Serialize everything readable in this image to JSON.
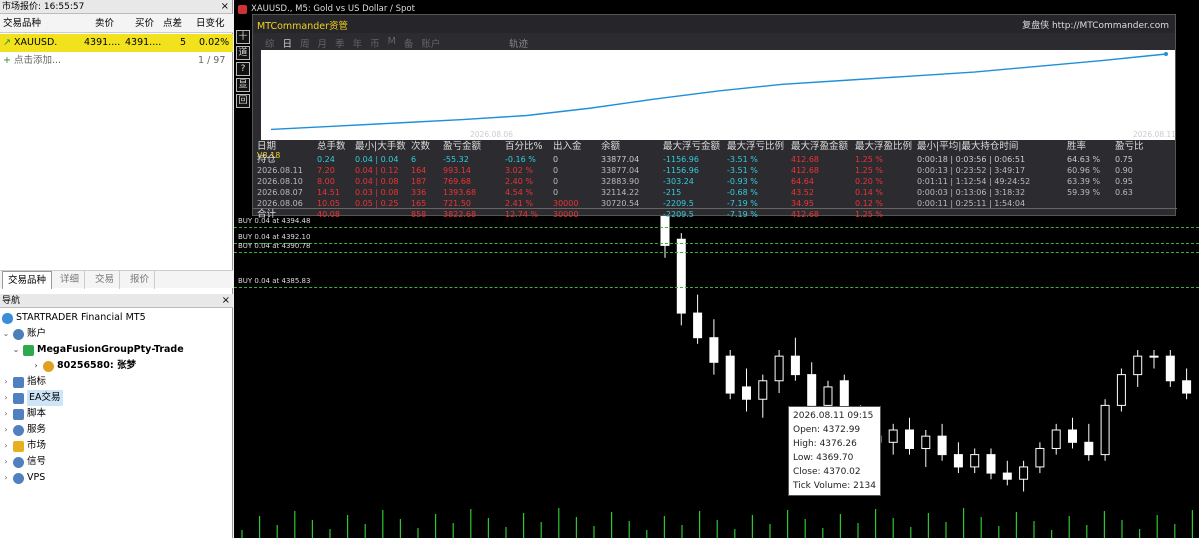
{
  "market_watch": {
    "title": "市场报价: 16:55:57",
    "columns": [
      "交易品种",
      "卖价",
      "买价",
      "点差",
      "日变化"
    ],
    "rows": [
      {
        "symbol": "XAUUSD.",
        "bid": "4391....",
        "ask": "4391....",
        "spread": "5",
        "change": "0.02%"
      }
    ],
    "add_label": "点击添加...",
    "count": "1 / 97",
    "tabs": [
      "交易品种",
      "详细",
      "交易",
      "报价"
    ]
  },
  "navigator": {
    "title": "导航",
    "items": [
      {
        "label": "STARTRADER Financial MT5",
        "color": "#3a8ed8"
      },
      {
        "label": "账户",
        "color": "#4a7fb8"
      },
      {
        "label": "MegaFusionGroupPty-Trade",
        "color": "#2fa84e"
      },
      {
        "label": "80256580: 张梦",
        "color": "#e0a020"
      },
      {
        "label": "指标",
        "color": "#5080c0"
      },
      {
        "label": "EA交易",
        "color": "#5080c0"
      },
      {
        "label": "脚本",
        "color": "#5080c0"
      },
      {
        "label": "服务",
        "color": "#5080c0"
      },
      {
        "label": "市场",
        "color": "#e8b020"
      },
      {
        "label": "信号",
        "color": "#5080c0"
      },
      {
        "label": "VPS",
        "color": "#5080c0"
      }
    ]
  },
  "chart": {
    "title": "XAUUSD., M5:  Gold vs US Dollar / Spot",
    "toolbar": [
      "十",
      "道",
      "?",
      "显",
      "回"
    ]
  },
  "mtc": {
    "title": "MTCommander资管",
    "link": "复盘侠  http://MTCommander.com",
    "tabs": [
      "综",
      "日",
      "周",
      "月",
      "季",
      "年",
      "币",
      "M",
      "备",
      "账户"
    ],
    "traj": "轨迹",
    "date_start": "2026.08.06",
    "date_end": "2026.08.11",
    "version": "V8.18",
    "equity": [
      0.08,
      0.12,
      0.16,
      0.2,
      0.25,
      0.34,
      0.45,
      0.55,
      0.63,
      0.68,
      0.73,
      0.78,
      0.85,
      0.92,
      1.0
    ],
    "headers": [
      "日期",
      "总手数",
      "最小|大手数",
      "次数",
      "盈亏金额",
      "百分比%",
      "出入金",
      "余额",
      "最大浮亏金额",
      "最大浮亏比例",
      "最大浮盈金额",
      "最大浮盈比例",
      "最小|平均|最大持仓时间",
      "胜率",
      "盈亏比"
    ],
    "rows": [
      [
        "持仓",
        "0.24",
        "0.04 | 0.04",
        "6",
        "-55.32",
        "-0.16 %",
        "0",
        "33877.04",
        "-1156.96",
        "-3.51 %",
        "412.68",
        "1.25 %",
        "0:00:18 | 0:03:56 | 0:06:51",
        "64.63 %",
        "0.75"
      ],
      [
        "2026.08.11",
        "7.20",
        "0.04 | 0.12",
        "164",
        "993.14",
        "3.02 %",
        "0",
        "33877.04",
        "-1156.96",
        "-3.51 %",
        "412.68",
        "1.25 %",
        "0:00:13 | 0:23:52 | 3:49:17",
        "60.96 %",
        "0.90"
      ],
      [
        "2026.08.10",
        "8.00",
        "0.04 | 0.08",
        "187",
        "769.68",
        "2.40 %",
        "0",
        "32883.90",
        "-303.24",
        "-0.93 %",
        "64.64",
        "0.20 %",
        "0:01:11 | 1:12:54 | 49:24:52",
        "63.39 %",
        "0.95"
      ],
      [
        "2026.08.07",
        "14.51",
        "0.03 | 0.08",
        "336",
        "1393.68",
        "4.54 %",
        "0",
        "32114.22",
        "-215",
        "-0.68 %",
        "43.52",
        "0.14 %",
        "0:00:03 | 0:13:06 | 3:18:32",
        "59.39 %",
        "0.63"
      ],
      [
        "2026.08.06",
        "10.05",
        "0.05 | 0.25",
        "165",
        "721.50",
        "2.41 %",
        "30000",
        "30720.54",
        "-2209.5",
        "-7.19 %",
        "34.95",
        "0.12 %",
        "0:00:11 | 0:25:11 | 1:54:04",
        "",
        ""
      ],
      [
        "合计",
        "40.08",
        "",
        "858",
        "3822.68",
        "12.74 %",
        "30000",
        "",
        "-2209.5",
        "-7.19 %",
        "412.68",
        "1.25 %",
        "",
        "",
        ""
      ]
    ]
  },
  "positions": [
    "BUY 0.04 at 4394.48",
    "BUY 0.04 at 4392.10",
    "BUY 0.04 at 4390.78",
    "BUY 0.04 at 4385.83"
  ],
  "tooltip": {
    "date": "2026.08.11 09:15",
    "open": "Open: 4372.99",
    "high": "High: 4376.26",
    "low": "Low: 4369.70",
    "close": "Close: 4370.02",
    "volume": "Tick Volume: 2134"
  },
  "candles": [
    {
      "o": 4398,
      "h": 4400,
      "l": 4391,
      "c": 4393
    },
    {
      "o": 4394,
      "h": 4395,
      "l": 4380,
      "c": 4382
    },
    {
      "o": 4382,
      "h": 4385,
      "l": 4377,
      "c": 4378
    },
    {
      "o": 4378,
      "h": 4381,
      "l": 4372,
      "c": 4374
    },
    {
      "o": 4375,
      "h": 4376,
      "l": 4368,
      "c": 4369
    },
    {
      "o": 4370,
      "h": 4373,
      "l": 4366,
      "c": 4368
    },
    {
      "o": 4368,
      "h": 4372,
      "l": 4365,
      "c": 4371
    },
    {
      "o": 4371,
      "h": 4376,
      "l": 4369,
      "c": 4375
    },
    {
      "o": 4375,
      "h": 4378,
      "l": 4371,
      "c": 4372
    },
    {
      "o": 4372,
      "h": 4374,
      "l": 4366,
      "c": 4367
    },
    {
      "o": 4367,
      "h": 4371,
      "l": 4366,
      "c": 4370
    },
    {
      "o": 4371,
      "h": 4372,
      "l": 4364,
      "c": 4365
    },
    {
      "o": 4365,
      "h": 4367,
      "l": 4361,
      "c": 4362
    },
    {
      "o": 4362,
      "h": 4364,
      "l": 4359,
      "c": 4361
    },
    {
      "o": 4361,
      "h": 4364,
      "l": 4359,
      "c": 4363
    },
    {
      "o": 4363,
      "h": 4365,
      "l": 4359,
      "c": 4360
    },
    {
      "o": 4360,
      "h": 4363,
      "l": 4357,
      "c": 4362
    },
    {
      "o": 4362,
      "h": 4364,
      "l": 4358,
      "c": 4359
    },
    {
      "o": 4359,
      "h": 4361,
      "l": 4356,
      "c": 4357
    },
    {
      "o": 4357,
      "h": 4360,
      "l": 4356,
      "c": 4359
    },
    {
      "o": 4359,
      "h": 4360,
      "l": 4355,
      "c": 4356
    },
    {
      "o": 4356,
      "h": 4358,
      "l": 4354,
      "c": 4355
    },
    {
      "o": 4355,
      "h": 4358,
      "l": 4353,
      "c": 4357
    },
    {
      "o": 4357,
      "h": 4361,
      "l": 4356,
      "c": 4360
    },
    {
      "o": 4360,
      "h": 4364,
      "l": 4359,
      "c": 4363
    },
    {
      "o": 4363,
      "h": 4365,
      "l": 4360,
      "c": 4361
    },
    {
      "o": 4361,
      "h": 4364,
      "l": 4358,
      "c": 4359
    },
    {
      "o": 4359,
      "h": 4368,
      "l": 4358,
      "c": 4367
    },
    {
      "o": 4367,
      "h": 4373,
      "l": 4366,
      "c": 4372
    },
    {
      "o": 4372,
      "h": 4376,
      "l": 4370,
      "c": 4375
    },
    {
      "o": 4375,
      "h": 4376,
      "l": 4373,
      "c": 4375
    },
    {
      "o": 4375,
      "h": 4376,
      "l": 4370,
      "c": 4371
    },
    {
      "o": 4371,
      "h": 4373,
      "l": 4368,
      "c": 4369
    }
  ]
}
